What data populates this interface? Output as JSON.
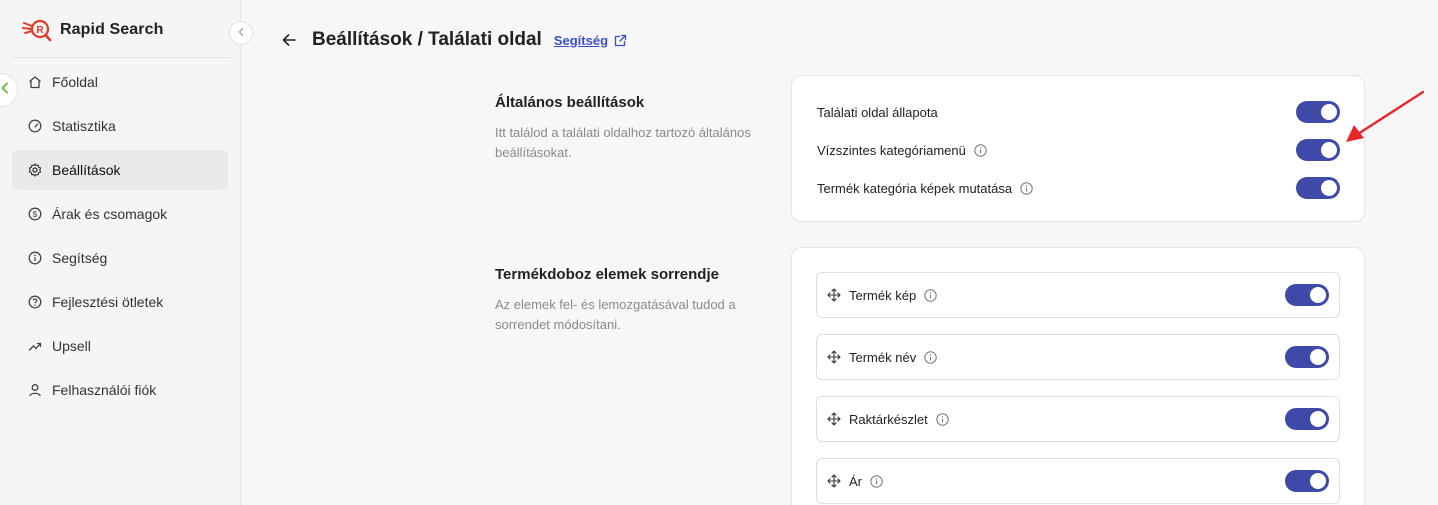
{
  "app": {
    "name": "Rapid Search",
    "logo_letter": "R"
  },
  "sidebar": {
    "items": [
      {
        "label": "Főoldal",
        "icon": "home-icon"
      },
      {
        "label": "Statisztika",
        "icon": "gauge-icon"
      },
      {
        "label": "Beállítások",
        "icon": "gear-icon",
        "active": true
      },
      {
        "label": "Árak és csomagok",
        "icon": "dollar-icon"
      },
      {
        "label": "Segítség",
        "icon": "info-icon"
      },
      {
        "label": "Fejlesztési ötletek",
        "icon": "question-icon"
      },
      {
        "label": "Upsell",
        "icon": "trend-up-icon"
      },
      {
        "label": "Felhasználói fiók",
        "icon": "user-icon"
      }
    ]
  },
  "header": {
    "title": "Beállítások / Találati oldal",
    "help_label": "Segítség"
  },
  "general": {
    "title": "Általános beállítások",
    "description": "Itt találod a találati oldalhoz tartozó általános beállításokat.",
    "rows": [
      {
        "label": "Találati oldal állapota",
        "info": false,
        "enabled": true
      },
      {
        "label": "Vízszintes kategóriamenü",
        "info": true,
        "enabled": true
      },
      {
        "label": "Termék kategória képek mutatása",
        "info": true,
        "enabled": true
      }
    ]
  },
  "order": {
    "title": "Termékdoboz elemek sorrendje",
    "description": "Az elemek fel- és lemozgatásával tudod a sorrendet módosítani.",
    "items": [
      {
        "label": "Termék kép",
        "enabled": true
      },
      {
        "label": "Termék név",
        "enabled": true
      },
      {
        "label": "Raktárkészlet",
        "enabled": true
      },
      {
        "label": "Ár",
        "enabled": true
      }
    ]
  },
  "colors": {
    "accent": "#3f4aa8",
    "link": "#3b4fc7",
    "brand": "#e5392b",
    "annotation": "#e8262a"
  }
}
